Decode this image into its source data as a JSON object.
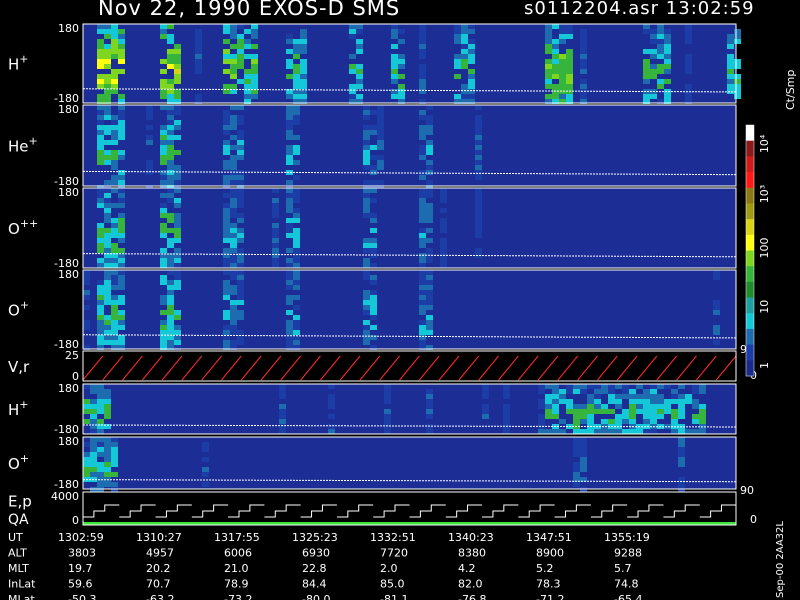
{
  "header": {
    "title": "Nov 22, 1990    EXOS-D SMS",
    "file_time": "s0112204.asr  13:02:59"
  },
  "panels": [
    {
      "label": "H",
      "sup": "+",
      "ymax": "180",
      "ymin": "-180"
    },
    {
      "label": "He",
      "sup": "+",
      "ymax": "180",
      "ymin": "-180"
    },
    {
      "label": "O",
      "sup": "++",
      "ymax": "180",
      "ymin": "-180"
    },
    {
      "label": "O",
      "sup": "+",
      "ymax": "180",
      "ymin": "-180"
    },
    {
      "label": "V,r",
      "sup": "",
      "ymax": "25",
      "ymin": "0",
      "right_top": "90",
      "right_bottom": "0"
    },
    {
      "label": "H",
      "sup": "+",
      "ymax": "180",
      "ymin": "-180"
    },
    {
      "label": "O",
      "sup": "+",
      "ymax": "180",
      "ymin": "-180"
    },
    {
      "label": "E,p",
      "label2": "QA",
      "sup": "",
      "ymax": "4000",
      "ymin": "0",
      "right_top": "90",
      "right_bottom": "0"
    }
  ],
  "colorbar": {
    "unit": "Ct/Smp",
    "tick_labels": [
      "10⁴",
      "10³",
      "100",
      "10",
      "1"
    ],
    "colors": [
      "#ffffff",
      "#8b1a1a",
      "#d11a1a",
      "#ff1a1a",
      "#8b7a14",
      "#a09a14",
      "#d8d314",
      "#ffff10",
      "#7fd61e",
      "#37b43c",
      "#1f8c2d",
      "#1e9ea0",
      "#14c8d8",
      "#1e6cb0",
      "#1c3ca6",
      "#1a2a8c"
    ]
  },
  "footer": {
    "row_labels": [
      "UT",
      "ALT",
      "MLT",
      "InLat",
      "MLat"
    ],
    "columns": [
      [
        "1302:59",
        "3803",
        "19.7",
        "59.6",
        "-50.3"
      ],
      [
        "1310:27",
        "4957",
        "20.2",
        "70.7",
        "-63.2"
      ],
      [
        "1317:55",
        "6006",
        "21.0",
        "78.9",
        "-73.2"
      ],
      [
        "1325:23",
        "6930",
        "22.8",
        "84.4",
        "-80.0"
      ],
      [
        "1332:51",
        "7720",
        "2.0",
        "85.0",
        "-81.1"
      ],
      [
        "1340:23",
        "8380",
        "4.2",
        "82.0",
        "-76.8"
      ],
      [
        "1347:51",
        "8900",
        "5.2",
        "78.3",
        "-71.2"
      ],
      [
        "1355:19",
        "9288",
        "5.7",
        "74.8",
        "-65.4"
      ]
    ],
    "side_note": "Sep-00 2AA32L"
  },
  "chart_data": {
    "type": "heatmap",
    "title": "Nov 22, 1990    EXOS-D SMS",
    "x_ticks_ut": [
      "1302:59",
      "1310:27",
      "1317:55",
      "1325:23",
      "1332:51",
      "1340:23",
      "1347:51",
      "1355:19"
    ],
    "colorbar_unit": "Ct/Smp",
    "colorbar_scale": "log",
    "colorbar_range": [
      1,
      10000
    ],
    "panels": [
      {
        "name": "H+",
        "y_range": [
          -180,
          180
        ],
        "bursts": [
          [
            0.02,
            0.06,
            5
          ],
          [
            0.11,
            0.14,
            5
          ],
          [
            0.21,
            0.26,
            4
          ],
          [
            0.31,
            0.34,
            3
          ],
          [
            0.4,
            0.42,
            3
          ],
          [
            0.47,
            0.49,
            3
          ],
          [
            0.56,
            0.6,
            3
          ],
          [
            0.7,
            0.75,
            4
          ],
          [
            0.85,
            0.9,
            3
          ],
          [
            0.98,
            1.0,
            3
          ]
        ]
      },
      {
        "name": "He+",
        "y_range": [
          -180,
          180
        ],
        "bursts": [
          [
            0.02,
            0.06,
            3
          ],
          [
            0.11,
            0.14,
            3
          ],
          [
            0.21,
            0.24,
            2
          ],
          [
            0.31,
            0.33,
            2
          ],
          [
            0.42,
            0.44,
            2
          ],
          [
            0.51,
            0.53,
            2
          ]
        ]
      },
      {
        "name": "O++",
        "y_range": [
          -180,
          180
        ],
        "bursts": [
          [
            0.02,
            0.06,
            3
          ],
          [
            0.11,
            0.14,
            3
          ],
          [
            0.21,
            0.24,
            2
          ],
          [
            0.31,
            0.33,
            2
          ],
          [
            0.42,
            0.44,
            2
          ],
          [
            0.51,
            0.53,
            2
          ]
        ]
      },
      {
        "name": "O+",
        "y_range": [
          -180,
          180
        ],
        "bursts": [
          [
            0.02,
            0.06,
            3
          ],
          [
            0.11,
            0.14,
            3
          ],
          [
            0.21,
            0.24,
            2
          ],
          [
            0.31,
            0.33,
            2
          ],
          [
            0.42,
            0.44,
            2
          ],
          [
            0.51,
            0.53,
            2
          ]
        ]
      },
      {
        "name": "H+",
        "y_range": [
          -180,
          180
        ],
        "bursts": [
          [
            0.0,
            0.04,
            3
          ],
          [
            0.7,
            0.75,
            3
          ],
          [
            0.75,
            0.8,
            3
          ],
          [
            0.8,
            0.85,
            3
          ],
          [
            0.85,
            0.9,
            3
          ],
          [
            0.9,
            0.95,
            3
          ]
        ]
      },
      {
        "name": "O+",
        "y_range": [
          -180,
          180
        ],
        "bursts": [
          [
            0.0,
            0.05,
            3
          ]
        ]
      }
    ],
    "sweeps": {
      "v_r": {
        "y_range": [
          0,
          25
        ],
        "count": 33
      },
      "e_p": {
        "y_range": [
          0,
          4000
        ],
        "count": 18
      }
    }
  }
}
